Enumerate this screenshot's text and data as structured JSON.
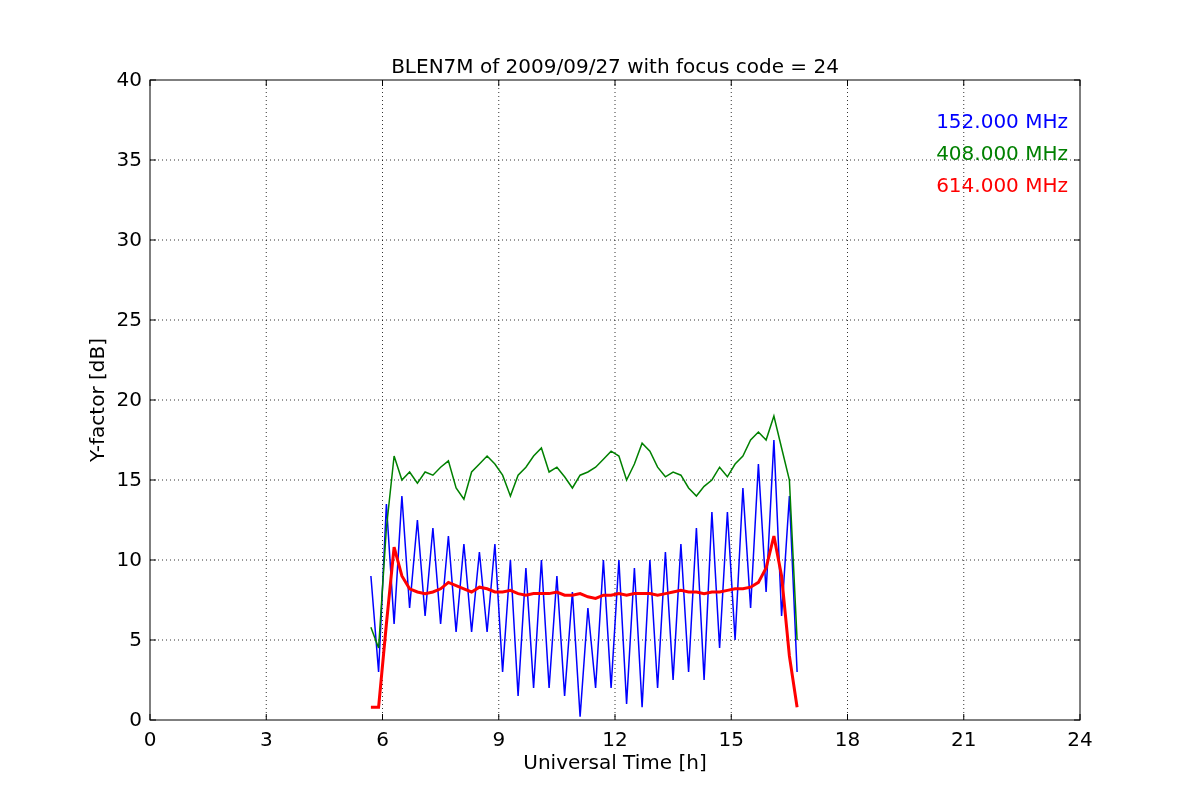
{
  "chart_data": {
    "type": "line",
    "title": "BLEN7M of 2009/09/27 with focus code = 24",
    "xlabel": "Universal Time [h]",
    "ylabel": "Y-factor [dB]",
    "x": [
      5.7,
      5.9,
      6.1,
      6.3,
      6.5,
      6.7,
      6.9,
      7.1,
      7.3,
      7.5,
      7.7,
      7.9,
      8.1,
      8.3,
      8.5,
      8.7,
      8.9,
      9.1,
      9.3,
      9.5,
      9.7,
      9.9,
      10.1,
      10.3,
      10.5,
      10.7,
      10.9,
      11.1,
      11.3,
      11.5,
      11.7,
      11.9,
      12.1,
      12.3,
      12.5,
      12.7,
      12.9,
      13.1,
      13.3,
      13.5,
      13.7,
      13.9,
      14.1,
      14.3,
      14.5,
      14.7,
      14.9,
      15.1,
      15.3,
      15.5,
      15.7,
      15.9,
      16.1,
      16.3,
      16.5,
      16.7
    ],
    "series": [
      {
        "name": "152.000 MHz",
        "color": "#0000ff",
        "values": [
          9,
          3,
          13.5,
          6,
          14,
          7,
          12.5,
          6.5,
          12,
          6,
          11.5,
          5.5,
          11,
          5.5,
          10.5,
          5.5,
          11,
          3,
          10,
          1.5,
          9.5,
          2,
          10,
          2,
          9,
          1.5,
          8,
          0.2,
          7,
          2,
          10,
          2,
          10,
          1,
          9.5,
          0.8,
          10,
          2,
          10.5,
          2.5,
          11,
          3,
          12,
          2.5,
          13,
          4.5,
          13,
          5,
          14.5,
          7,
          16,
          8,
          17.5,
          6.5,
          14,
          3
        ]
      },
      {
        "name": "408.000 MHz",
        "color": "#008000",
        "values": [
          5.8,
          4.5,
          12,
          16.5,
          15,
          15.5,
          14.8,
          15.5,
          15.3,
          15.8,
          16.2,
          14.5,
          13.8,
          15.5,
          16,
          16.5,
          16,
          15.3,
          14,
          15.3,
          15.8,
          16.5,
          17,
          15.5,
          15.8,
          15.2,
          14.5,
          15.3,
          15.5,
          15.8,
          16.3,
          16.8,
          16.5,
          15,
          16,
          17.3,
          16.8,
          15.8,
          15.2,
          15.5,
          15.3,
          14.5,
          14,
          14.6,
          15,
          15.8,
          15.2,
          16,
          16.5,
          17.5,
          18,
          17.5,
          19,
          17,
          15,
          5
        ]
      },
      {
        "name": "614.000 MHz",
        "color": "#ff0000",
        "values": [
          0.8,
          0.8,
          6,
          10.8,
          9,
          8.2,
          8,
          7.9,
          8,
          8.2,
          8.6,
          8.4,
          8.2,
          8,
          8.3,
          8.2,
          8,
          8,
          8.1,
          7.9,
          7.8,
          7.9,
          7.9,
          7.9,
          8,
          7.8,
          7.8,
          7.9,
          7.7,
          7.6,
          7.8,
          7.8,
          7.9,
          7.8,
          7.9,
          7.9,
          7.9,
          7.8,
          7.9,
          8,
          8.1,
          8,
          8,
          7.9,
          8,
          8,
          8.1,
          8.2,
          8.2,
          8.3,
          8.6,
          9.5,
          11.5,
          9,
          4,
          0.8
        ]
      }
    ],
    "xlim": [
      0,
      24
    ],
    "ylim": [
      0,
      40
    ],
    "xticks": [
      0,
      3,
      6,
      9,
      12,
      15,
      18,
      21,
      24
    ],
    "yticks": [
      0,
      5,
      10,
      15,
      20,
      25,
      30,
      35,
      40
    ],
    "grid": true
  }
}
